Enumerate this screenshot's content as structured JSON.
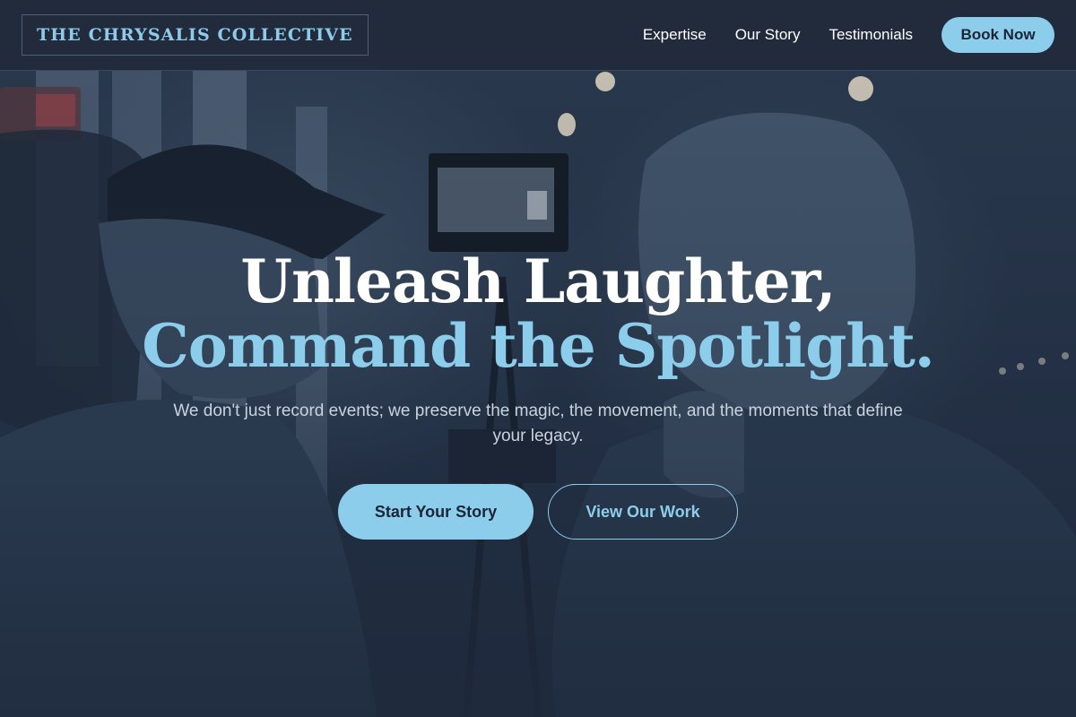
{
  "brand": {
    "name": "THE CHRYSALIS COLLECTIVE"
  },
  "nav": {
    "links": [
      "Expertise",
      "Our Story",
      "Testimonials"
    ],
    "cta_label": "Book Now"
  },
  "hero": {
    "headline_line1": "Unleash Laughter,",
    "headline_line2": "Command the Spotlight.",
    "subtitle": "We don't just record events; we preserve the magic, the movement, and the moments that define your legacy.",
    "primary_cta": "Start Your Story",
    "secondary_cta": "View Our Work",
    "background_image": "photo of two videographers operating a camera rig in a dim venue with hanging bulbs and an exit sign"
  },
  "colors": {
    "background": "#1f2a3d",
    "header": "#222b3c",
    "accent": "#8ccdec",
    "text": "#ffffff",
    "muted_text": "#c9d3df"
  }
}
